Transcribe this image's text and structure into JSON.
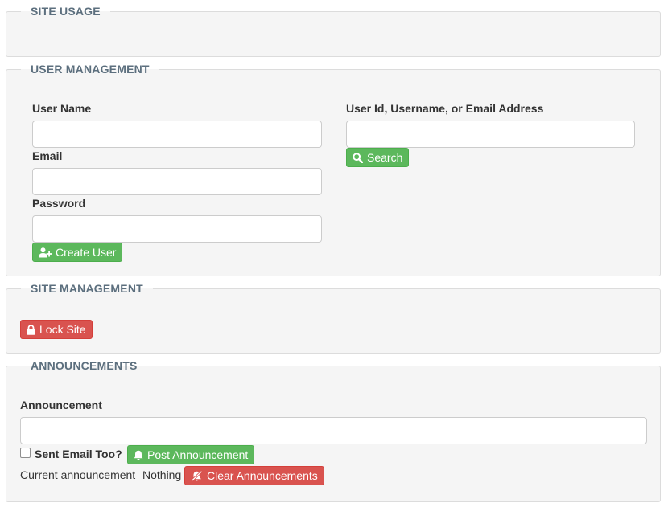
{
  "site_usage": {
    "legend": "SITE USAGE"
  },
  "user_management": {
    "legend": "USER MANAGEMENT",
    "user_name_label": "User Name",
    "user_name_value": "",
    "email_label": "Email",
    "email_value": "",
    "password_label": "Password",
    "password_value": "",
    "create_user_label": "Create User",
    "search_label_text": "User Id, Username, or Email Address",
    "search_value": "",
    "search_button_label": "Search"
  },
  "site_management": {
    "legend": "SITE MANAGEMENT",
    "lock_site_label": "Lock Site"
  },
  "announcements": {
    "legend": "ANNOUNCEMENTS",
    "announcement_label": "Announcement",
    "announcement_value": "",
    "sent_email_label": "Sent Email Too?",
    "sent_email_checked": false,
    "post_label": "Post Announcement",
    "current_prefix": "Current announcement",
    "current_value": "Nothing",
    "clear_label": "Clear Announcements"
  },
  "icons": {
    "create_user": "user-plus-icon",
    "search": "search-icon",
    "lock": "lock-icon",
    "bell": "bell-icon",
    "bell_slash": "bell-slash-icon"
  },
  "colors": {
    "success": "#5cb85c",
    "danger": "#d9534f",
    "legend": "#5c6f7e",
    "panel_bg": "#f5f5f5"
  }
}
